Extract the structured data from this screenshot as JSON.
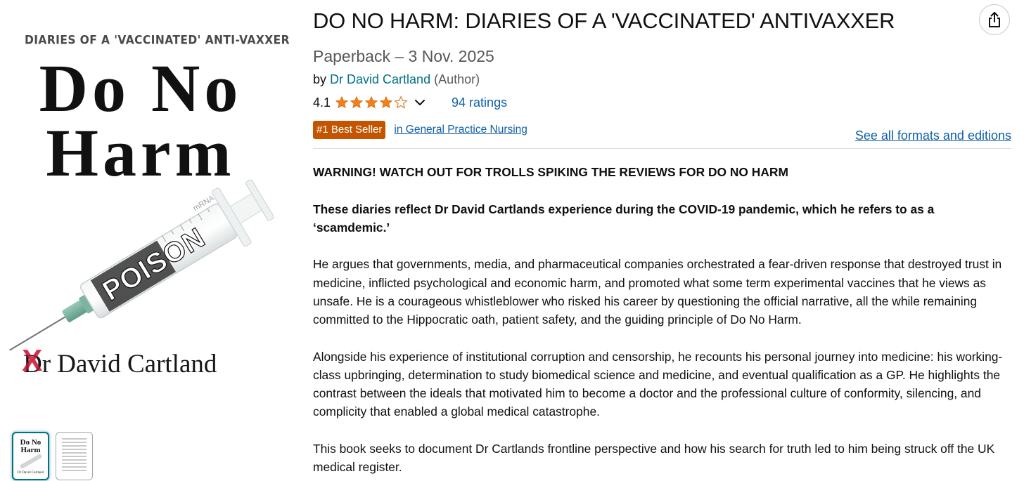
{
  "cover": {
    "top_text": "DIARIES OF A 'VACCINATED' ANTI-VAXXER",
    "title_line1": "Do No",
    "title_line2": "Harm",
    "syringe_label": "POISON",
    "syringe_small_label": "mRNA",
    "author": "Dr David Cartland",
    "x_mark": "X"
  },
  "thumbnails": [
    {
      "title": "Do No Harm",
      "author": "Dr David Cartland",
      "selected": true
    },
    {
      "selected": false
    }
  ],
  "product": {
    "title": "DO NO HARM: DIARIES OF A 'VACCINATED' ANTIVAXXER",
    "format": "Paperback – 3 Nov. 2025",
    "by_prefix": "by",
    "author": "Dr David Cartland",
    "author_role": "(Author)",
    "rating_value": "4.1",
    "rating_stars": 4.1,
    "ratings_count": "94 ratings",
    "badge": "#1 Best Seller",
    "badge_category": "in General Practice Nursing",
    "formats_link": "See all formats and editions"
  },
  "description": {
    "p1": "WARNING! WATCH OUT FOR TROLLS SPIKING THE REVIEWS FOR DO NO HARM",
    "p2": "These diaries reflect Dr David Cartlands experience during the COVID-19 pandemic, which he refers to as a ‘scamdemic.’",
    "p3": "He argues that governments, media, and pharmaceutical companies orchestrated a fear-driven response that destroyed trust in medicine, inflicted psychological and economic harm, and promoted what some term experimental vaccines that he views as unsafe. He is a courageous whistleblower who risked his career by questioning the official narrative, all the while remaining committed to the Hippocratic oath, patient safety, and the guiding principle of Do No Harm.",
    "p4": "Alongside his experience of institutional corruption and censorship, he recounts his personal journey into medicine: his working-class upbringing, determination to study biomedical science and medicine, and eventual qualification as a GP. He highlights the contrast between the ideals that motivated him to become a doctor and the professional culture of conformity, silencing, and complicity that enabled a global medical catastrophe.",
    "p5": "This book seeks to document Dr Cartlands frontline perspective and how his search for truth led to him being struck off the UK medical register."
  },
  "icons": {
    "share": "share-icon",
    "chevron": "chevron-down-icon",
    "star": "star-icon"
  },
  "colors": {
    "link": "#007185",
    "link_blue": "#0f5fa8",
    "star": "#f3801a",
    "badge": "#c45500",
    "text": "#0f1111",
    "muted": "#565959"
  }
}
